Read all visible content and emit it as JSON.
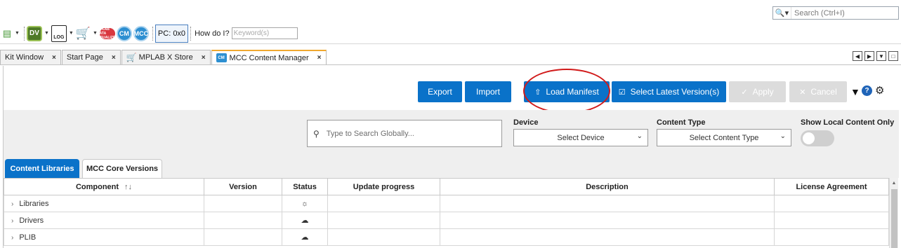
{
  "top_search": {
    "placeholder": "Search (Ctrl+I)",
    "icon": "search-icon"
  },
  "toolbar": {
    "dv_label": "DV",
    "log_label": "LOG",
    "plot_label": "MPLAB DATA VISUALIZER",
    "cm_label": "CM",
    "mcc_label": "MCC",
    "pc_label": "PC: 0x0",
    "howdoi_label": "How do I?",
    "keyword_placeholder": "Keyword(s)"
  },
  "doc_tabs": [
    {
      "label": "Kit Window"
    },
    {
      "label": "Start Page"
    },
    {
      "label": "MPLAB X Store"
    },
    {
      "label": "MCC Content Manager",
      "active": true
    }
  ],
  "actions": {
    "export": "Export",
    "import": "Import",
    "load_manifest": "Load Manifest",
    "select_latest": "Select Latest Version(s)",
    "apply": "Apply",
    "cancel": "Cancel"
  },
  "filters": {
    "search_placeholder": "Type to Search Globally...",
    "device_label": "Device",
    "device_value": "Select Device",
    "content_type_label": "Content Type",
    "content_type_value": "Select Content Type",
    "show_local_label": "Show Local Content Only",
    "show_local_on": false
  },
  "sub_tabs": {
    "content_libraries": "Content Libraries",
    "core_versions": "MCC Core Versions"
  },
  "table": {
    "headers": {
      "component": "Component",
      "version": "Version",
      "status": "Status",
      "progress": "Update progress",
      "description": "Description",
      "license": "License Agreement"
    },
    "rows": [
      {
        "component": "Libraries",
        "status_icon": "sun-icon",
        "status_glyph": "☼"
      },
      {
        "component": "Drivers",
        "status_icon": "cloud-icon",
        "status_glyph": "☁"
      },
      {
        "component": "PLIB",
        "status_icon": "cloud-icon",
        "status_glyph": "☁"
      }
    ]
  },
  "colors": {
    "primary": "#0a72c9",
    "disabled": "#dcdcdc",
    "annotation": "#d11a1a"
  }
}
